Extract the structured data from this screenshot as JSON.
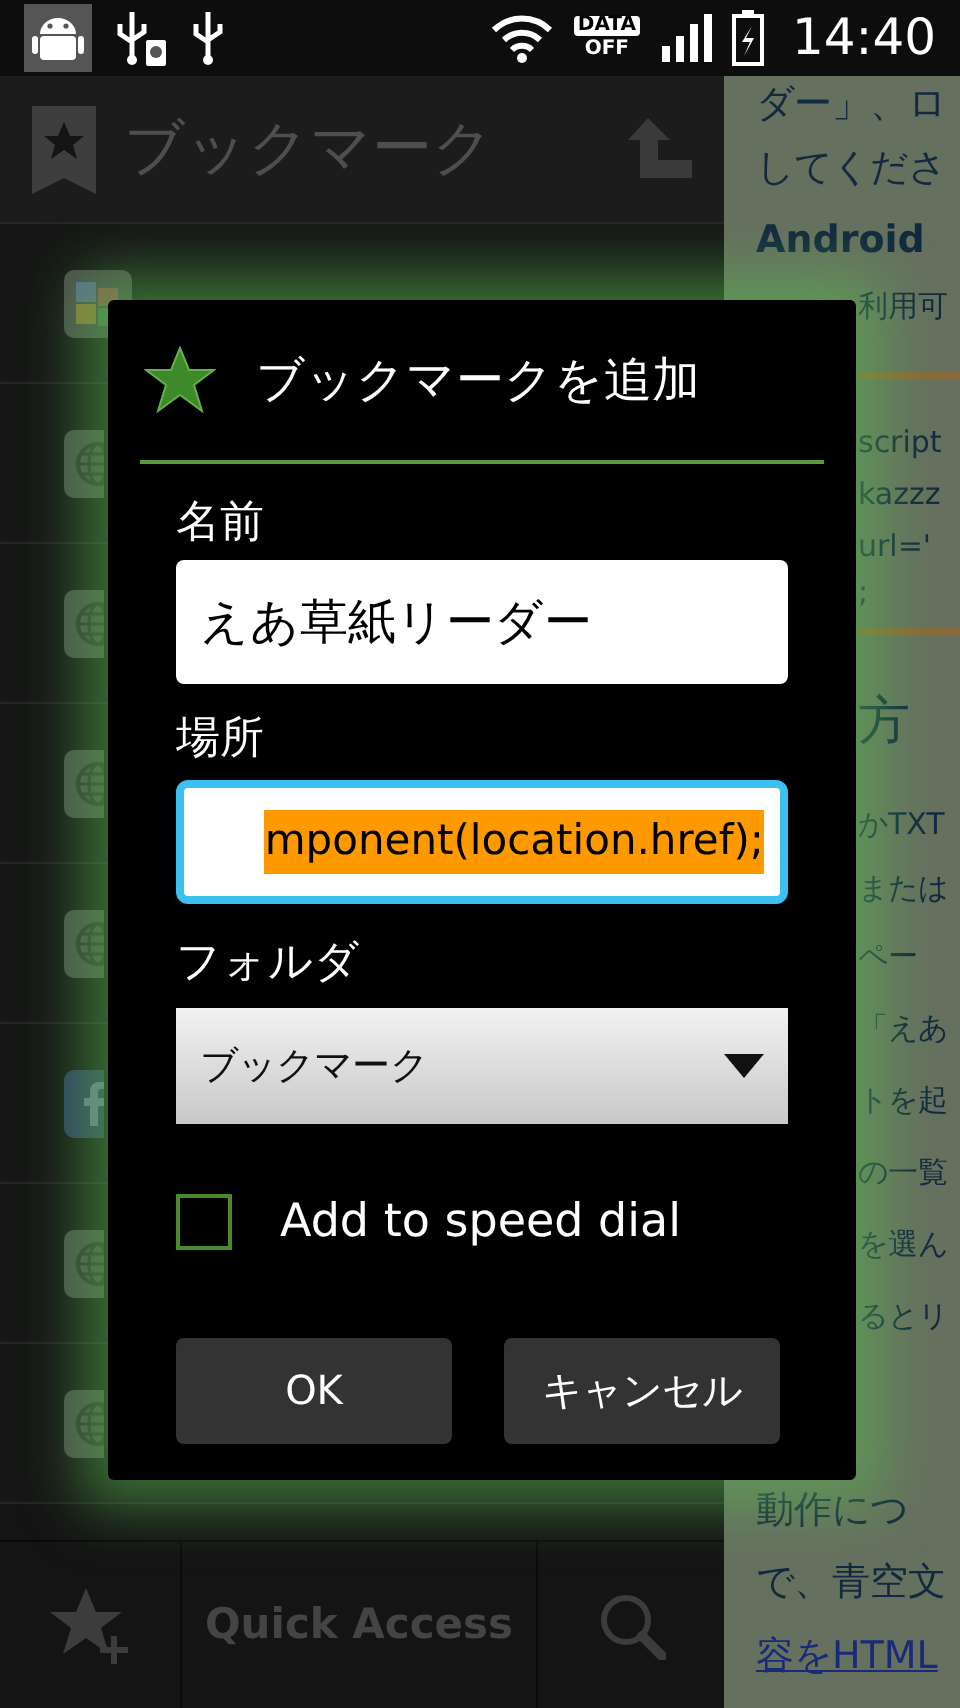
{
  "status_bar": {
    "data_badge": "DATA",
    "data_state": "OFF",
    "time": "14:40"
  },
  "action_bar": {
    "title": "ブックマーク"
  },
  "bookmark_list": [
    {
      "kind": "google"
    },
    {
      "kind": "globe"
    },
    {
      "kind": "globe"
    },
    {
      "kind": "globe"
    },
    {
      "kind": "globe"
    },
    {
      "kind": "facebook"
    },
    {
      "kind": "globe"
    },
    {
      "kind": "globe"
    }
  ],
  "web_page": {
    "lines": [
      {
        "kind": "text",
        "text": "ダー」、ロ"
      },
      {
        "kind": "text",
        "text": "してくださ"
      },
      {
        "kind": "bold",
        "text": "Android"
      },
      {
        "kind": "text",
        "text": "利用可"
      },
      {
        "kind": "rule"
      },
      {
        "kind": "text",
        "text": "script"
      },
      {
        "kind": "text",
        "text": "kazzz"
      },
      {
        "kind": "text",
        "text": "url='"
      },
      {
        "kind": "text",
        "text": ";"
      },
      {
        "kind": "rule"
      },
      {
        "kind": "heading",
        "text": "方"
      },
      {
        "kind": "text",
        "text": "かTXT"
      },
      {
        "kind": "text",
        "text": "または"
      },
      {
        "kind": "text",
        "text": "ペー"
      },
      {
        "kind": "text",
        "text": "「えあ"
      },
      {
        "kind": "text",
        "text": "トを起"
      },
      {
        "kind": "text",
        "text": "の一覧"
      },
      {
        "kind": "text",
        "text": "を選ん"
      },
      {
        "kind": "text",
        "text": "るとリ"
      },
      {
        "kind": "text",
        "text": "動作につ"
      },
      {
        "kind": "text",
        "text": "で、青空文"
      },
      {
        "kind": "link",
        "text": "容をHTML"
      }
    ]
  },
  "dialog": {
    "title": "ブックマークを追加",
    "name_label": "名前",
    "name_value": "えあ草紙リーダー",
    "location_label": "場所",
    "location_value": "mponent(location.href);",
    "location_focused": true,
    "folder_label": "フォルダ",
    "folder_value": "ブックマーク",
    "speed_dial": {
      "label": "Add to speed dial",
      "checked": false
    },
    "buttons": [
      "OK",
      "キャンセル"
    ]
  },
  "bottom_bar": {
    "quick_access": "Quick Access"
  }
}
